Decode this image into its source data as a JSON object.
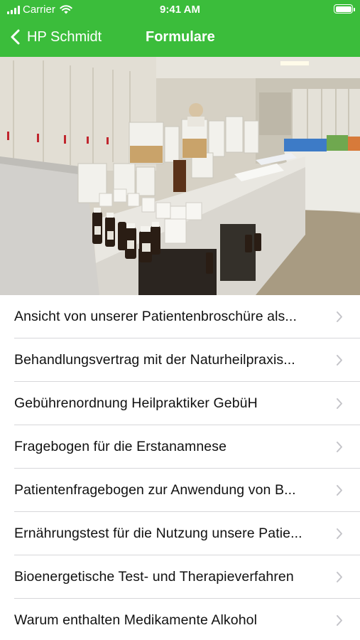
{
  "status_bar": {
    "carrier": "Carrier",
    "time": "9:41 AM"
  },
  "nav": {
    "back_label": "HP Schmidt",
    "title": "Formulare"
  },
  "hero_image": {
    "description": "photo"
  },
  "items": [
    {
      "label": "Ansicht von unserer Patientenbroschüre als..."
    },
    {
      "label": "Behandlungsvertrag mit der Naturheilpraxis..."
    },
    {
      "label": "Gebührenordnung Heilpraktiker GebüH"
    },
    {
      "label": "Fragebogen für die Erstanamnese"
    },
    {
      "label": "Patientenfragebogen zur Anwendung von B..."
    },
    {
      "label": "Ernährungstest für die Nutzung unsere Patie..."
    },
    {
      "label": "Bioenergetische Test- und Therapieverfahren"
    },
    {
      "label": "Warum enthalten Medikamente Alkohol"
    }
  ],
  "colors": {
    "header": "#3bbd3b",
    "separator": "#d7d7da",
    "chevron": "#c4c4c9"
  }
}
